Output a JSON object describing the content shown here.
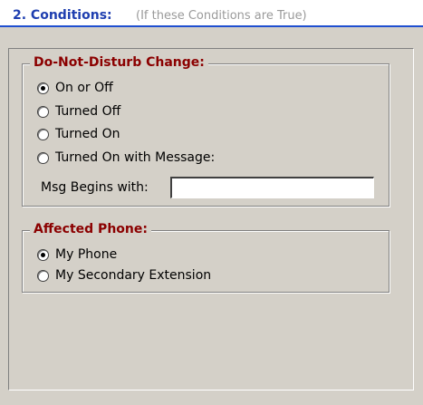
{
  "header": {
    "section_title": "2. Conditions:",
    "hint": "(If these Conditions are True)"
  },
  "dnd_group": {
    "title": "Do-Not-Disturb Change:",
    "options": [
      {
        "label": "On or Off",
        "checked": true
      },
      {
        "label": "Turned Off",
        "checked": false
      },
      {
        "label": "Turned On",
        "checked": false
      },
      {
        "label": "Turned On with Message:",
        "checked": false
      }
    ],
    "msg_label": "Msg Begins with:",
    "msg_value": ""
  },
  "phone_group": {
    "title": "Affected Phone:",
    "options": [
      {
        "label": "My Phone",
        "checked": true
      },
      {
        "label": "My Secondary Extension",
        "checked": false
      }
    ]
  }
}
